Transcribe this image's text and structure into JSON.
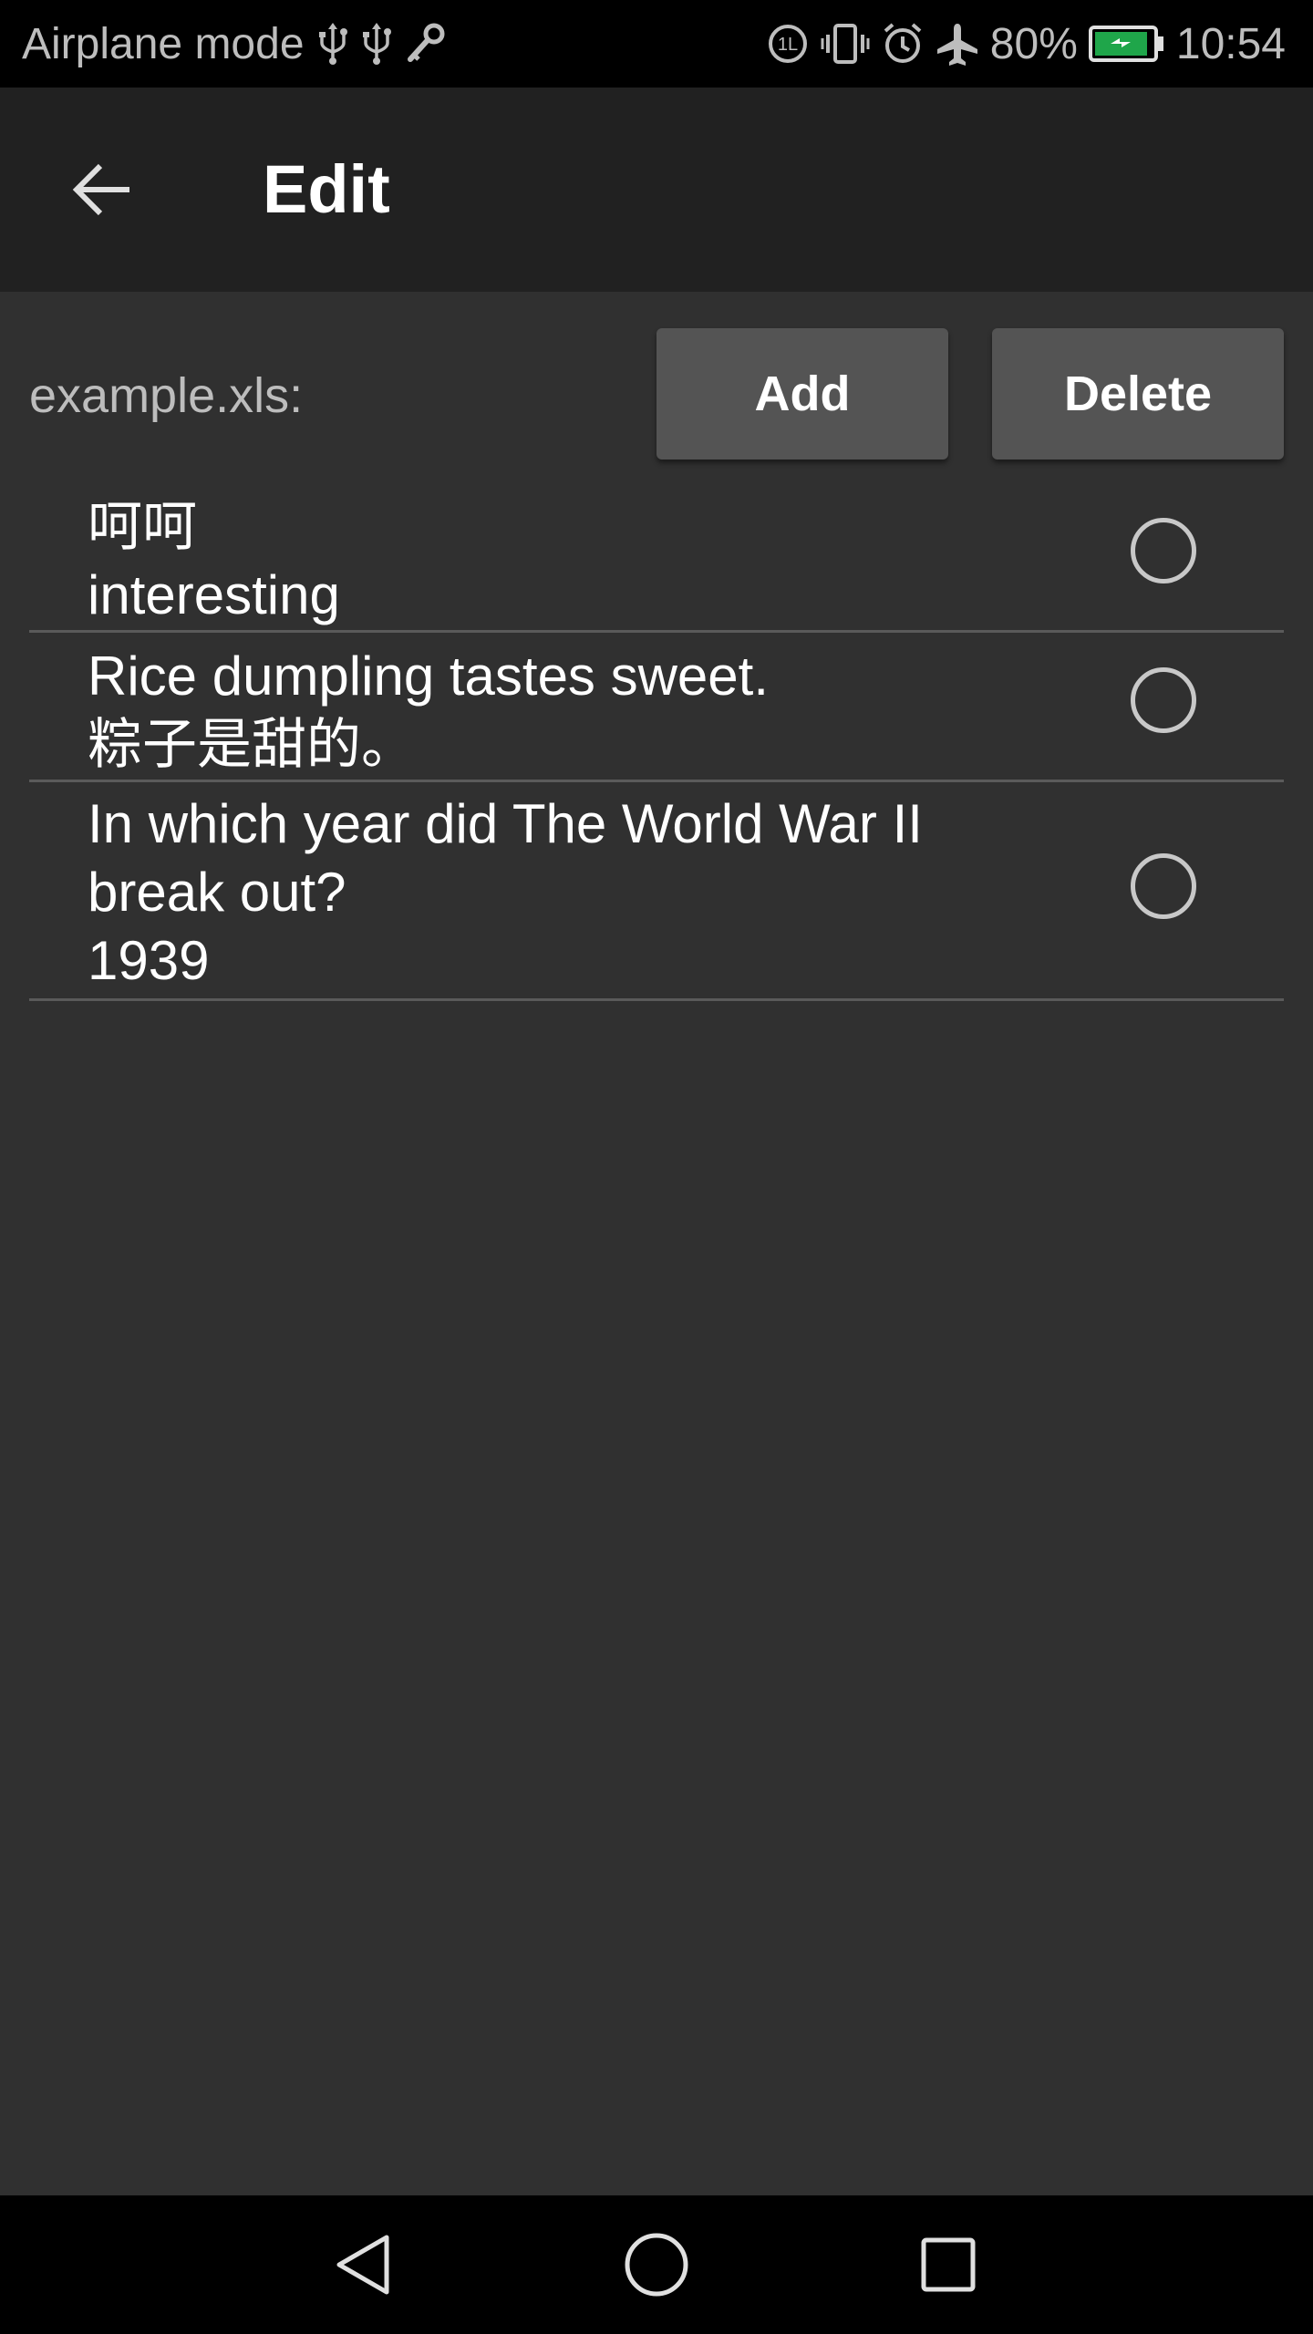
{
  "status_bar": {
    "carrier_text": "Airplane mode",
    "battery_percent": "80%",
    "time": "10:54",
    "icons_left": [
      "usb-icon",
      "usb-icon",
      "key-icon"
    ],
    "icons_right": [
      "data-saver-icon",
      "vibrate-icon",
      "alarm-icon",
      "airplane-icon",
      "battery-icon"
    ],
    "battery_color": "#1fa64a"
  },
  "toolbar": {
    "title": "Edit",
    "back_icon": "arrow-left-icon"
  },
  "header": {
    "file_label": "example.xls:",
    "add_label": "Add",
    "delete_label": "Delete"
  },
  "items": [
    {
      "line1": "呵呵",
      "line2": "interesting",
      "selected": false
    },
    {
      "line1": "Rice dumpling tastes sweet.",
      "line2": "粽子是甜的。",
      "selected": false
    },
    {
      "line1": "In which year did The World War II",
      "line2": "break out?",
      "line3": "1939",
      "selected": false
    }
  ],
  "nav_bar": {
    "icons": [
      "back-triangle-icon",
      "home-circle-icon",
      "recents-square-icon"
    ]
  },
  "colors": {
    "background": "#303030",
    "toolbar": "#212121",
    "button": "#545454",
    "divider": "#5a5a5a"
  }
}
